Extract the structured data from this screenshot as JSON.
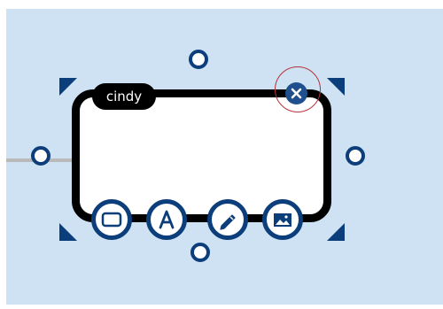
{
  "node": {
    "label": "cindy"
  },
  "icons": {
    "close": "close-icon",
    "shape": "rectangle-shape-icon",
    "text": "text-format-icon",
    "edit": "pencil-icon",
    "image": "image-icon"
  },
  "colors": {
    "canvas_background": "#cfe2f3",
    "accent": "#0b3e7a",
    "close_button": "#1f4f8c",
    "node_border": "#000000",
    "connector": "#b9b9b9",
    "highlight_ring": "#b5323c"
  }
}
